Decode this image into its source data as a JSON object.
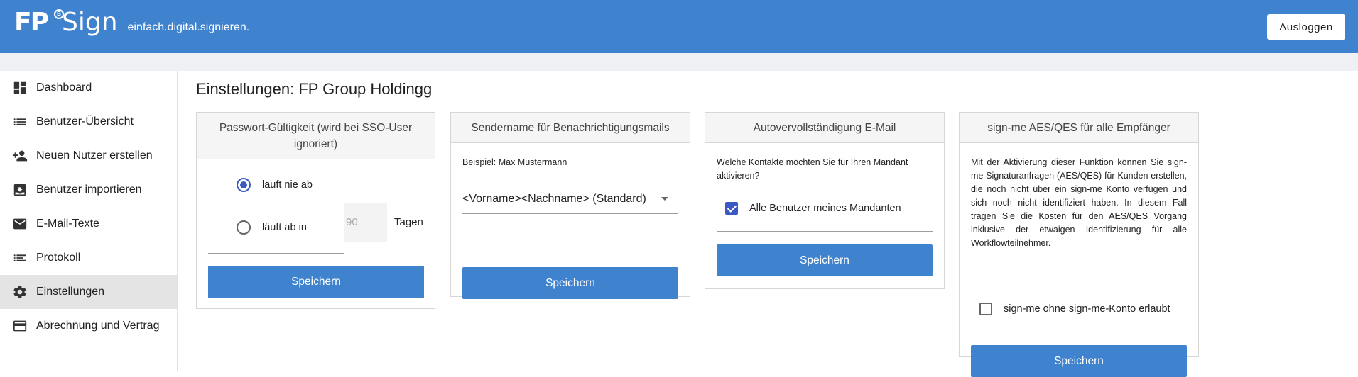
{
  "header": {
    "logo_fp": "FP",
    "logo_reg": "B",
    "logo_sign": "Sign",
    "tagline": "einfach.digital.signieren.",
    "logout_label": "Ausloggen",
    "brand_color": "#3f83cf"
  },
  "sidebar": {
    "items": [
      {
        "label": "Dashboard",
        "icon": "dashboard-icon"
      },
      {
        "label": "Benutzer-Übersicht",
        "icon": "list-icon"
      },
      {
        "label": "Neuen Nutzer erstellen",
        "icon": "person-add-icon"
      },
      {
        "label": "Benutzer importieren",
        "icon": "import-icon"
      },
      {
        "label": "E-Mail-Texte",
        "icon": "mail-icon"
      },
      {
        "label": "Protokoll",
        "icon": "log-icon"
      },
      {
        "label": "Einstellungen",
        "icon": "gear-icon",
        "active": true
      },
      {
        "label": "Abrechnung und Vertrag",
        "icon": "credit-card-icon"
      }
    ]
  },
  "page": {
    "title": "Einstellungen: FP Group Holdingg"
  },
  "cards": {
    "password": {
      "title": "Passwort-Gültigkeit (wird bei SSO-User ignoriert)",
      "option_never": "läuft nie ab",
      "option_expires": "läuft ab in",
      "days_placeholder": "90",
      "days_unit": "Tagen",
      "selected": "never",
      "save_label": "Speichern"
    },
    "sender": {
      "title": "Sendername für Benachrichtigungsmails",
      "hint": "Beispiel: Max Mustermann",
      "select_value": "<Vorname><Nachname> (Standard)",
      "input_value": "",
      "save_label": "Speichern"
    },
    "autocomplete": {
      "title": "Autovervollständigung E-Mail",
      "hint": "Welche Kontakte möchten Sie für Ihren Mandant aktivieren?",
      "checkbox_label": "Alle Benutzer meines Mandanten",
      "checked": true,
      "save_label": "Speichern"
    },
    "signme": {
      "title": "sign-me AES/QES für alle Empfänger",
      "description": "Mit der Aktivierung dieser Funktion können Sie sign-me Signaturanfragen (AES/QES) für Kunden erstellen, die noch nicht über ein sign-me Konto verfügen und sich noch nicht identifiziert haben. In diesem Fall tragen Sie die Kosten für den AES/QES Vorgang inklusive der etwaigen Identifizierung für alle Workflowteilnehmer.",
      "checkbox_label": "sign-me ohne sign-me-Konto erlaubt",
      "checked": false,
      "save_label": "Speichern"
    }
  }
}
